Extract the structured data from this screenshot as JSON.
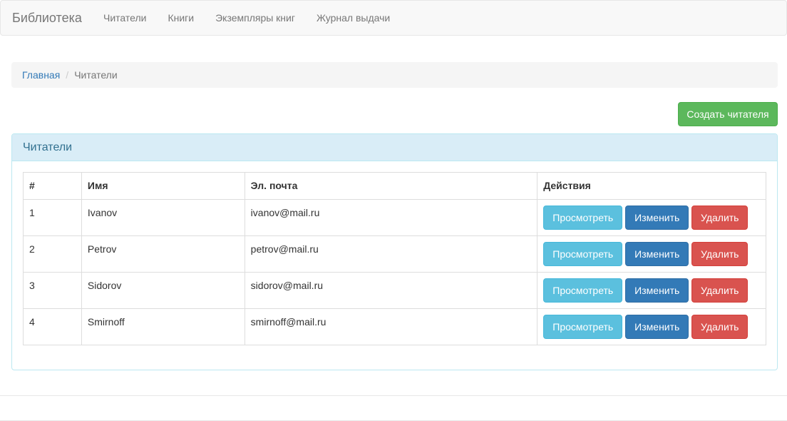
{
  "navbar": {
    "brand": "Библиотека",
    "links": [
      "Читатели",
      "Книги",
      "Экземпляры книг",
      "Журнал выдачи"
    ]
  },
  "breadcrumb": {
    "home": "Главная",
    "separator": "/",
    "current": "Читатели"
  },
  "create_button": "Создать читателя",
  "panel": {
    "title": "Читатели",
    "columns": [
      "#",
      "Имя",
      "Эл. почта",
      "Действия"
    ],
    "rows": [
      {
        "id": "1",
        "name": "Ivanov",
        "email": "ivanov@mail.ru"
      },
      {
        "id": "2",
        "name": "Petrov",
        "email": "petrov@mail.ru"
      },
      {
        "id": "3",
        "name": "Sidorov",
        "email": "sidorov@mail.ru"
      },
      {
        "id": "4",
        "name": "Smirnoff",
        "email": "smirnoff@mail.ru"
      }
    ],
    "actions": {
      "view": "Просмотреть",
      "edit": "Изменить",
      "delete": "Удалить"
    }
  },
  "colors": {
    "success": "#5cb85c",
    "info": "#5bc0de",
    "primary": "#337ab7",
    "danger": "#d9534f",
    "panel_heading": "#d9edf7"
  }
}
